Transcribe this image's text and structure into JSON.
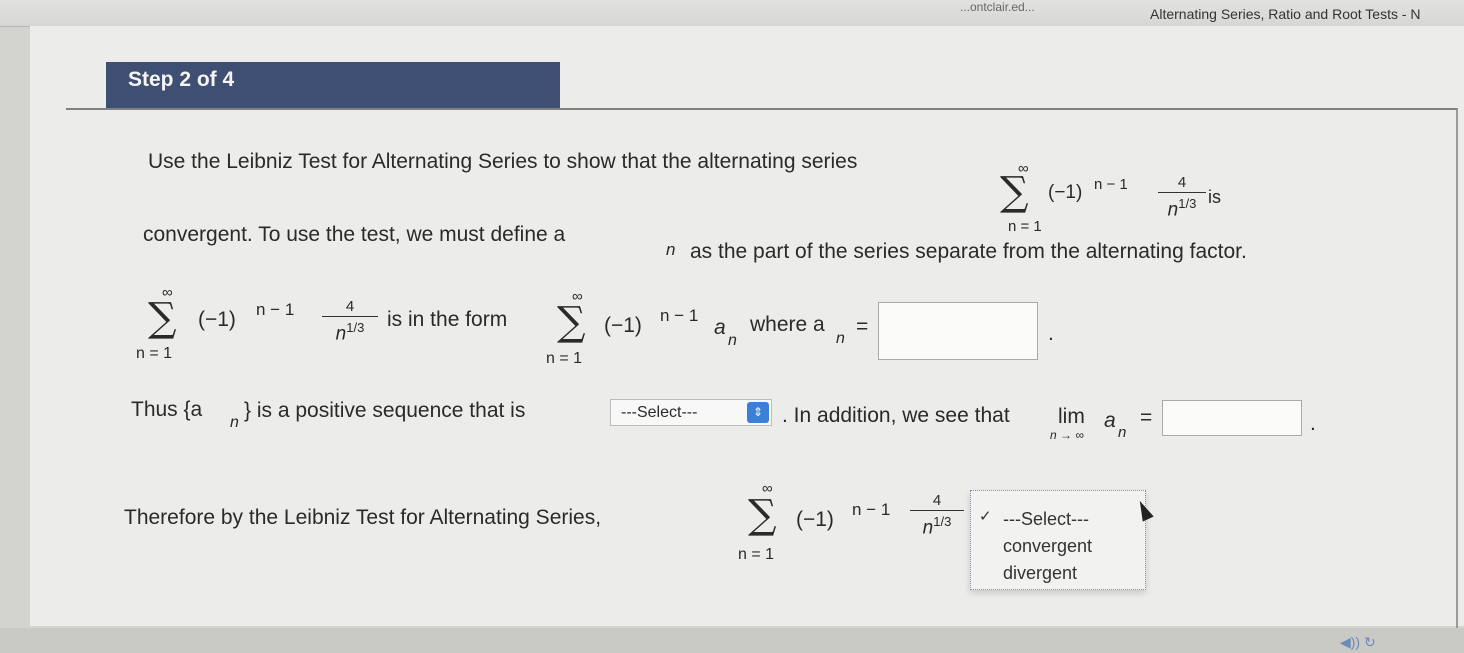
{
  "browser": {
    "url_fragment": "...ontclair.ed...",
    "tab_title": "Alternating Series, Ratio and Root Tests - N"
  },
  "step": {
    "label": "Step 2 of 4"
  },
  "problem": {
    "intro_part1": "Use the Leibniz Test for Alternating Series to show that the alternating series",
    "intro_is": "is",
    "intro_part2": "convergent. To use the test, we must define a",
    "intro_part2_sub": "n",
    "intro_part3": "as the part of the series separate from the alternating factor.",
    "series": {
      "upper": "∞",
      "lower": "n = 1",
      "sign_term": "(−1)",
      "exponent": "n − 1",
      "numerator": "4",
      "denominator": "n",
      "denominator_exp": "1/3"
    },
    "line2_mid": "is in the form",
    "line2_a": "a",
    "line2_a_sub": "n",
    "line2_where": "where a",
    "line2_where_sub": "n",
    "line2_eq": "=",
    "period1": ".",
    "line3_thus": "Thus {a",
    "line3_thus_sub": "n",
    "line3_rest": "} is a positive sequence that is",
    "line3_select": "---Select---",
    "line3_addition": ". In addition, we see that",
    "lim": "lim",
    "lim_sub": "n → ∞",
    "lim_a": "a",
    "lim_a_sub": "n",
    "lim_eq": "=",
    "period2": ".",
    "line4": "Therefore by the Leibniz Test for Alternating Series,"
  },
  "dropdown": {
    "check": "✓",
    "options": [
      "---Select---",
      "convergent",
      "divergent"
    ]
  },
  "footer": {
    "icon": "◀)) ↻"
  }
}
